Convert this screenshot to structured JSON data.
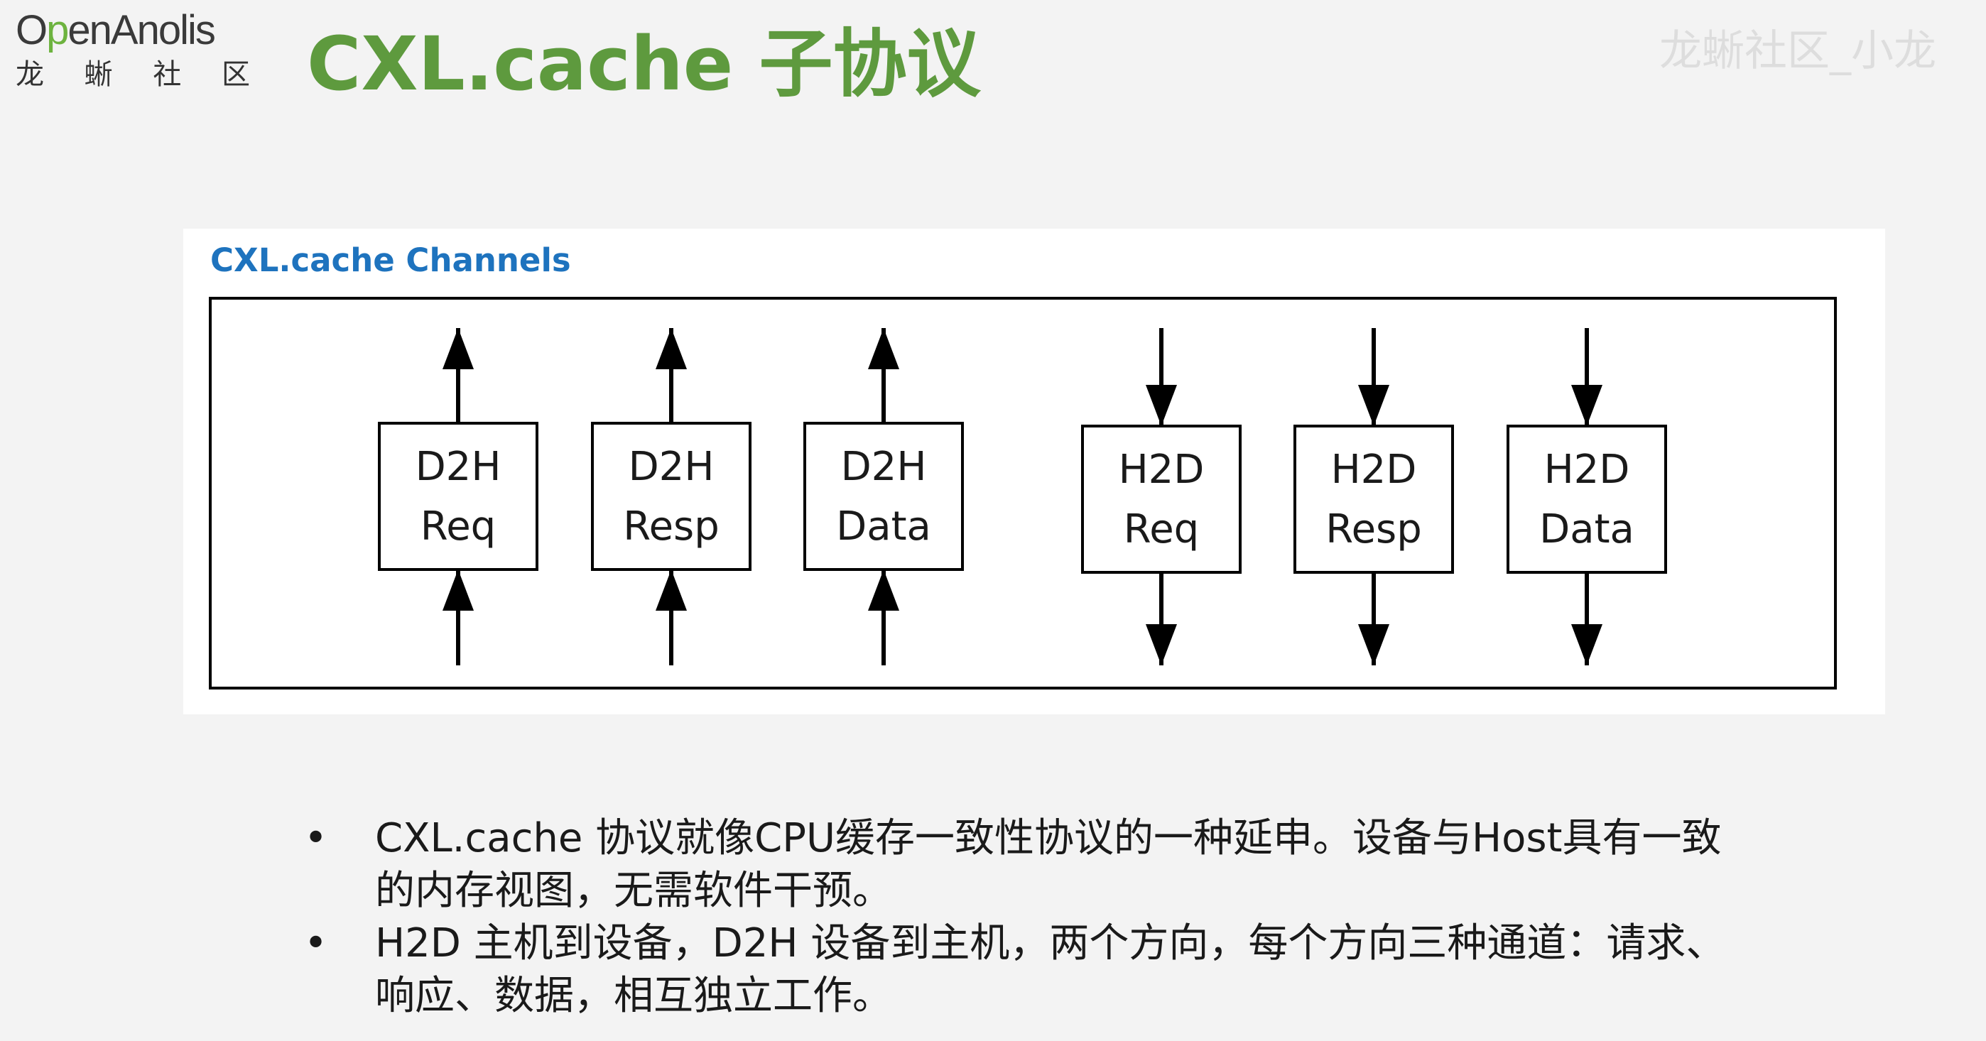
{
  "header": {
    "logo_en_prefix": "O",
    "logo_en_highlight": "p",
    "logo_en_suffix": "enAnolis",
    "logo_cn": [
      "龙",
      "蜥",
      "社",
      "区"
    ],
    "title": "CXL.cache 子协议",
    "watermark": "龙蜥社区_小龙"
  },
  "figure": {
    "title": "CXL.cache Channels",
    "channels": [
      {
        "line1": "D2H",
        "line2": "Req",
        "direction": "up"
      },
      {
        "line1": "D2H",
        "line2": "Resp",
        "direction": "up"
      },
      {
        "line1": "D2H",
        "line2": "Data",
        "direction": "up"
      },
      {
        "line1": "H2D",
        "line2": "Req",
        "direction": "down"
      },
      {
        "line1": "H2D",
        "line2": "Resp",
        "direction": "down"
      },
      {
        "line1": "H2D",
        "line2": "Data",
        "direction": "down"
      }
    ]
  },
  "bullets": [
    {
      "marker": "•",
      "lines": [
        "CXL.cache 协议就像CPU缓存一致性协议的一种延申。设备与Host具有一致",
        "的内存视图，无需软件干预。"
      ]
    },
    {
      "marker": "•",
      "lines": [
        "H2D 主机到设备，D2H 设备到主机，两个方向，每个方向三种通道：请求、",
        "响应、数据，相互独立工作。"
      ]
    }
  ],
  "colors": {
    "title_green": "#5e9a3e",
    "logo_green": "#6db33f",
    "figure_title_blue": "#1e73be",
    "line_black": "#000000"
  }
}
